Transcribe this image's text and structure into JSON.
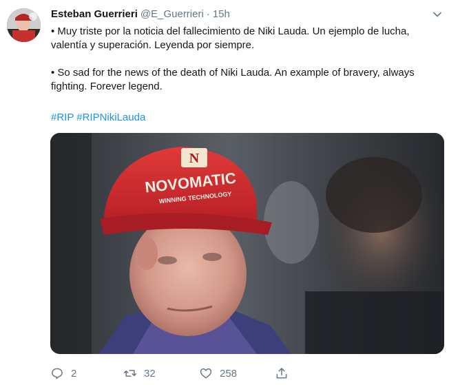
{
  "tweet": {
    "author": {
      "display_name": "Esteban Guerrieri",
      "handle": "@E_Guerrieri",
      "separator": "·",
      "timestamp": "15h"
    },
    "paragraphs": [
      "• Muy triste por la noticia del fallecimiento de Niki Lauda. Un ejemplo de lucha, valentía y superación. Leyenda por siempre.",
      "• So sad for the news of the death of Niki Lauda. An example of bravery, always fighting. Forever legend."
    ],
    "hashtags": [
      "#RIP",
      "#RIPNikiLauda"
    ],
    "photo": {
      "cap_logo_text": "NOVOMATIC",
      "cap_subtitle_text": "WINNING TECHNOLOGY",
      "cap_badge_letter": "N"
    },
    "actions": {
      "reply_count": "2",
      "retweet_count": "32",
      "like_count": "258",
      "icons": [
        "reply-icon",
        "retweet-icon",
        "like-icon",
        "share-icon"
      ]
    },
    "colors": {
      "link": "#1b95e0",
      "secondary_text": "#657786",
      "primary_text": "#14171a",
      "cap_red": "#d42a2f"
    }
  }
}
